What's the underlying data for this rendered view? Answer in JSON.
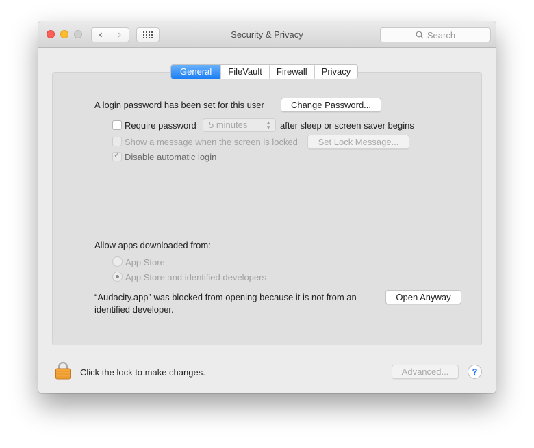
{
  "window": {
    "title": "Security & Privacy",
    "search_placeholder": "Search",
    "traffic_lights": [
      "close",
      "minimize",
      "zoom"
    ],
    "nav": {
      "back_icon": "chevron-left-icon",
      "forward_icon": "chevron-right-icon",
      "show_all_icon": "grid-icon"
    }
  },
  "tabs": [
    {
      "label": "General",
      "active": true
    },
    {
      "label": "FileVault",
      "active": false
    },
    {
      "label": "Firewall",
      "active": false
    },
    {
      "label": "Privacy",
      "active": false
    }
  ],
  "general": {
    "login_password_text": "A login password has been set for this user",
    "change_password_button": "Change Password...",
    "require_password": {
      "label": "Require password",
      "checked": false,
      "interval": "5 minutes",
      "suffix": "after sleep or screen saver begins"
    },
    "show_message": {
      "label": "Show a message when the screen is locked",
      "checked": false,
      "disabled": true,
      "button": "Set Lock Message..."
    },
    "disable_auto_login": {
      "label": "Disable automatic login",
      "checked": true,
      "disabled": true
    }
  },
  "downloads": {
    "heading": "Allow apps downloaded from:",
    "options": [
      {
        "label": "App Store",
        "selected": false
      },
      {
        "label": "App Store and identified developers",
        "selected": true
      }
    ],
    "blocked_message_line1": "“Audacity.app” was blocked from opening because it is not from an",
    "blocked_message_line2": "identified developer.",
    "open_anyway_button": "Open Anyway"
  },
  "footer": {
    "lock_text": "Click the lock to make changes.",
    "advanced_button": "Advanced...",
    "help_button": "?"
  },
  "colors": {
    "accent": "#1b7ef5",
    "lock": "#f0a33a"
  }
}
